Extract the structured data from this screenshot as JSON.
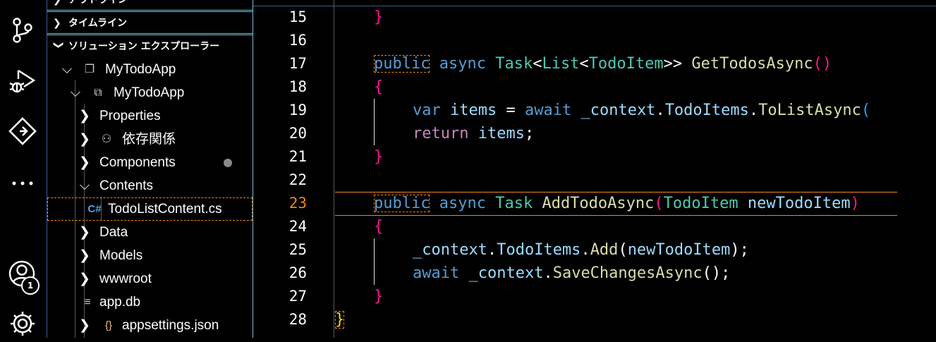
{
  "activity_bar": {
    "icons": [
      "source-control-icon",
      "run-debug-icon",
      "git-lens-icon",
      "more-icon",
      "accounts-icon",
      "settings-icon"
    ],
    "accounts_badge": "1"
  },
  "explorer": {
    "sections": {
      "outline": "アウトライン",
      "timeline": "タイムライン",
      "solution_explorer": "ソリューション エクスプローラー"
    },
    "tree": [
      {
        "label": "MyTodoApp",
        "icon": "solution-icon"
      },
      {
        "label": "MyTodoApp",
        "icon": "project-icon"
      },
      {
        "label": "Properties"
      },
      {
        "label": "依存関係",
        "icon": "dependencies-icon"
      },
      {
        "label": "Components"
      },
      {
        "label": "Contents"
      },
      {
        "label": "TodoListContent.cs",
        "icon": "csharp-file-icon"
      },
      {
        "label": "Data"
      },
      {
        "label": "Models"
      },
      {
        "label": "wwwroot"
      },
      {
        "label": "app.db",
        "icon": "file-icon"
      },
      {
        "label": "appsettings.json",
        "icon": "json-icon"
      }
    ]
  },
  "editor": {
    "current_line": "23",
    "lines": [
      {
        "n": "15",
        "tokens": [
          "}"
        ]
      },
      {
        "n": "16",
        "tokens": []
      },
      {
        "n": "17",
        "tokens": [
          "public",
          " ",
          "async",
          " ",
          "Task",
          "<",
          "List",
          "<",
          "TodoItem",
          ">>",
          " ",
          "GetTodosAsync",
          "(",
          ")"
        ]
      },
      {
        "n": "18",
        "tokens": [
          "{"
        ]
      },
      {
        "n": "19",
        "tokens": [
          "var",
          " ",
          "items",
          " = ",
          "await",
          " ",
          "_context",
          ".",
          "TodoItems",
          ".",
          "ToListAsync",
          "("
        ]
      },
      {
        "n": "20",
        "tokens": [
          "return",
          " ",
          "items",
          ";"
        ]
      },
      {
        "n": "21",
        "tokens": [
          "}"
        ]
      },
      {
        "n": "22",
        "tokens": []
      },
      {
        "n": "23",
        "tokens": [
          "public",
          " ",
          "async",
          " ",
          "Task",
          " ",
          "AddTodoAsync",
          "(",
          "TodoItem",
          " ",
          "newTodoItem",
          ")"
        ]
      },
      {
        "n": "24",
        "tokens": [
          "{"
        ]
      },
      {
        "n": "25",
        "tokens": [
          "_context",
          ".",
          "TodoItems",
          ".",
          "Add",
          "(",
          "newTodoItem",
          ");"
        ]
      },
      {
        "n": "26",
        "tokens": [
          "await",
          " ",
          "_context",
          ".",
          "SaveChangesAsync",
          "();"
        ]
      },
      {
        "n": "27",
        "tokens": [
          "}"
        ]
      },
      {
        "n": "28",
        "tokens": [
          "}"
        ]
      }
    ]
  }
}
